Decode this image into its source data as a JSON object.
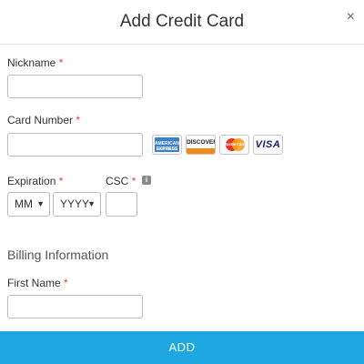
{
  "dialog": {
    "title": "Add Credit Card",
    "close_icon": "close-icon",
    "close_glyph": "×"
  },
  "form": {
    "required_marker": "*",
    "nickname": {
      "label": "Nickname",
      "value": "",
      "placeholder": ""
    },
    "card_number": {
      "label": "Card Number",
      "value": "",
      "placeholder": "",
      "accepted_cards": [
        {
          "name": "American Express",
          "text": "AMERICAN EXPRESS",
          "subtext": "BUSINESS",
          "icon": "amex-card-icon",
          "color": "#3b7fd1"
        },
        {
          "name": "Discover",
          "text": "DISCOVER",
          "icon": "discover-card-icon",
          "color": "#f18a1e"
        },
        {
          "name": "MasterCard",
          "text": "MasterCard",
          "icon": "mastercard-card-icon",
          "color": "#e6332a"
        },
        {
          "name": "Visa",
          "text": "VISA",
          "icon": "visa-card-icon",
          "color": "#1a1f71"
        }
      ]
    },
    "expiration": {
      "label": "Expiration",
      "month": {
        "value": "MM"
      },
      "year": {
        "value": "YYYY"
      }
    },
    "csc": {
      "label": "CSC",
      "value": "",
      "info_icon": "info-icon",
      "info_glyph": "i"
    },
    "billing": {
      "section_title": "Billing Information",
      "first_name": {
        "label": "First Name",
        "value": "",
        "placeholder": ""
      }
    }
  },
  "actions": {
    "add_label": "ADD",
    "accent_color": "#1ea7e1"
  }
}
